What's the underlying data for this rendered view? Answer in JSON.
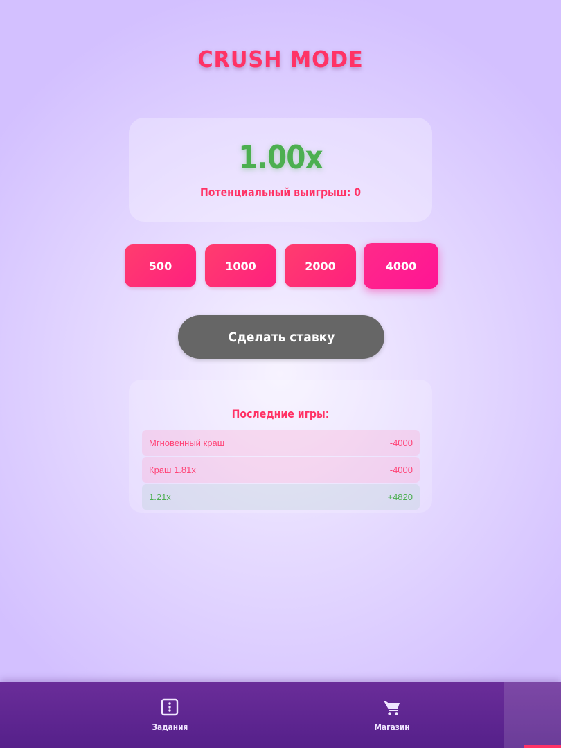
{
  "header": {
    "title": "CRUSH MODE"
  },
  "multiplier": {
    "value": "1.00x",
    "potential_label": "Потенциальный выигрыш: 0"
  },
  "bet_amounts": {
    "options": [
      "500",
      "1000",
      "2000",
      "4000"
    ],
    "selected": "4000"
  },
  "actions": {
    "place_bet_label": "Сделать ставку"
  },
  "history": {
    "title": "Последние игры:",
    "rows": [
      {
        "label": "Мгновенный краш",
        "amount": "-4000",
        "status": "loss"
      },
      {
        "label": "Краш 1.81x",
        "amount": "-4000",
        "status": "loss"
      },
      {
        "label": "1.21x",
        "amount": "+4820",
        "status": "win"
      }
    ]
  },
  "nav": {
    "items": [
      {
        "label": "Задания",
        "icon": "task-list-icon"
      },
      {
        "label": "Магазин",
        "icon": "shopping-cart-icon"
      }
    ]
  },
  "colors": {
    "accent": "#ff3366",
    "win": "#4caf50",
    "bet_button": "#ff1f7f",
    "place_bet_button": "#666666",
    "nav_background": "#5e2590"
  }
}
